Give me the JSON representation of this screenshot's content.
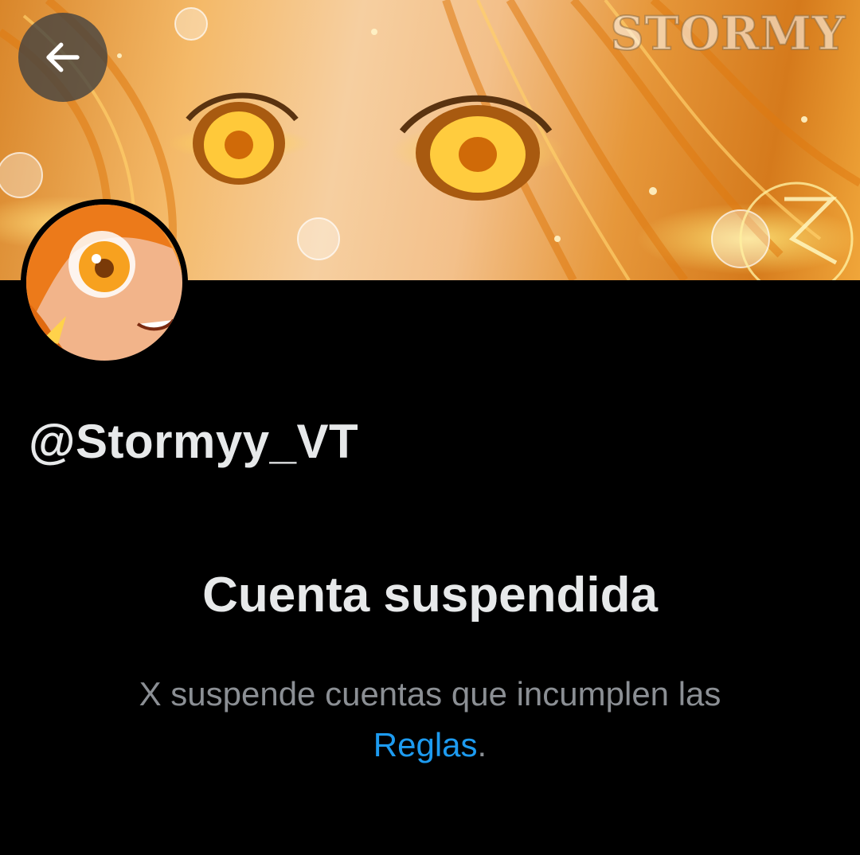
{
  "header": {
    "watermark": "STORMY",
    "back_button": {
      "icon": "arrow-left-icon"
    }
  },
  "profile": {
    "handle": "@Stormyy_VT"
  },
  "suspension": {
    "title": "Cuenta suspendida",
    "message_text": "X suspende cuentas que incumplen las",
    "rules_link": "Reglas",
    "period": "."
  },
  "colors": {
    "background": "#000000",
    "text_primary": "#e7e9ea",
    "text_secondary": "#8b8f94",
    "link": "#1d9bf0"
  }
}
